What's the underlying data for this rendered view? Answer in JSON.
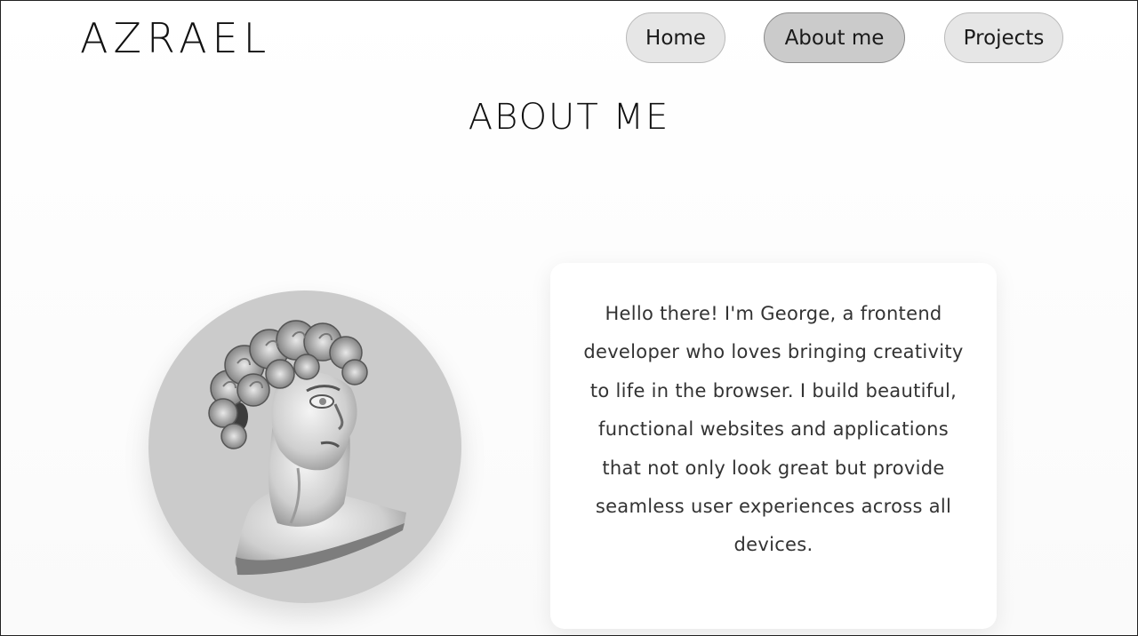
{
  "header": {
    "logo": "AZRAEL",
    "nav": [
      {
        "label": "Home",
        "active": false
      },
      {
        "label": "About me",
        "active": true
      },
      {
        "label": "Projects",
        "active": false
      }
    ]
  },
  "main": {
    "title": "ABOUT ME",
    "avatar_alt": "marble bust",
    "bio": "Hello there! I'm George, a frontend developer who loves bringing creativity to life in the browser. I build beautiful, functional websites and applications that not only look great but provide seamless user experiences across all devices."
  },
  "colors": {
    "nav_bg": "#e6e6e6",
    "nav_active_bg": "#cbcbcb",
    "avatar_bg": "#cbcbcb",
    "card_bg": "#ffffff",
    "text": "#111111"
  }
}
